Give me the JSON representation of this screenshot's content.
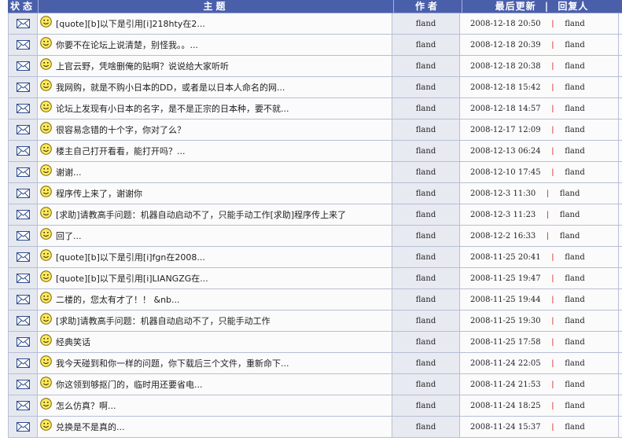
{
  "columns": {
    "status": "状态",
    "topic": "主题",
    "author": "作者",
    "last_update": "最后更新",
    "header_sep": "|",
    "last_reply": "回复人"
  },
  "icons": {
    "status": "envelope-icon",
    "topic": "smiley-icon"
  },
  "colors": {
    "header_bg": "#4a5faa",
    "separator": "#d81c1c"
  },
  "threads": [
    {
      "title": "[quote][b]以下是引用[i]218hty在2...",
      "author": "fland",
      "updated": "2008-12-18 20:50",
      "reply_by": "fland"
    },
    {
      "title": "你要不在论坛上说清楚，别怪我。。...",
      "author": "fland",
      "updated": "2008-12-18 20:39",
      "reply_by": "fland"
    },
    {
      "title": "上官云野，凭啥删俺的贴啊？说说给大家听听",
      "author": "fland",
      "updated": "2008-12-18 20:38",
      "reply_by": "fland"
    },
    {
      "title": "我网购，就是不购小日本的DD，或者是以日本人命名的网...",
      "author": "fland",
      "updated": "2008-12-18 15:42",
      "reply_by": "fland"
    },
    {
      "title": "论坛上发现有小日本的名字，是不是正宗的日本种，要不就...",
      "author": "fland",
      "updated": "2008-12-18 14:57",
      "reply_by": "fland"
    },
    {
      "title": "很容易念错的十个字，你对了么？",
      "author": "fland",
      "updated": "2008-12-17 12:09",
      "reply_by": "fland"
    },
    {
      "title": "楼主自己打开看看，能打开吗？...",
      "author": "fland",
      "updated": "2008-12-13 06:24",
      "reply_by": "fland"
    },
    {
      "title": "谢谢...",
      "author": "fland",
      "updated": "2008-12-10 17:45",
      "reply_by": "fland"
    },
    {
      "title": "程序传上来了，谢谢你",
      "author": "fland",
      "updated": "2008-12-3 11:30",
      "reply_by": "fland"
    },
    {
      "title": "[求助]请教高手问题：机器自动启动不了，只能手动工作[求助]程序传上来了",
      "author": "fland",
      "updated": "2008-12-3 11:23",
      "reply_by": "fland"
    },
    {
      "title": "回了...",
      "author": "fland",
      "updated": "2008-12-2 16:33",
      "reply_by": "fland"
    },
    {
      "title": "[quote][b]以下是引用[i]fgn在2008...",
      "author": "fland",
      "updated": "2008-11-25 20:41",
      "reply_by": "fland"
    },
    {
      "title": "[quote][b]以下是引用[i]LIANGZG在...",
      "author": "fland",
      "updated": "2008-11-25 19:47",
      "reply_by": "fland"
    },
    {
      "title": "二楼的，您太有才了！！ &nb...",
      "author": "fland",
      "updated": "2008-11-25 19:44",
      "reply_by": "fland"
    },
    {
      "title": "[求助]请教高手问题：机器自动启动不了，只能手动工作",
      "author": "fland",
      "updated": "2008-11-25 19:30",
      "reply_by": "fland"
    },
    {
      "title": "经典笑话",
      "author": "fland",
      "updated": "2008-11-25 17:58",
      "reply_by": "fland"
    },
    {
      "title": "我今天碰到和你一样的问题，你下载后三个文件，重新命下...",
      "author": "fland",
      "updated": "2008-11-24 22:05",
      "reply_by": "fland"
    },
    {
      "title": "你这领到够抠门的，临时用还要省电...",
      "author": "fland",
      "updated": "2008-11-24 21:53",
      "reply_by": "fland"
    },
    {
      "title": "怎么仿真？啊...",
      "author": "fland",
      "updated": "2008-11-24 18:25",
      "reply_by": "fland"
    },
    {
      "title": "兑换是不是真的...",
      "author": "fland",
      "updated": "2008-11-24 15:37",
      "reply_by": "fland"
    }
  ]
}
